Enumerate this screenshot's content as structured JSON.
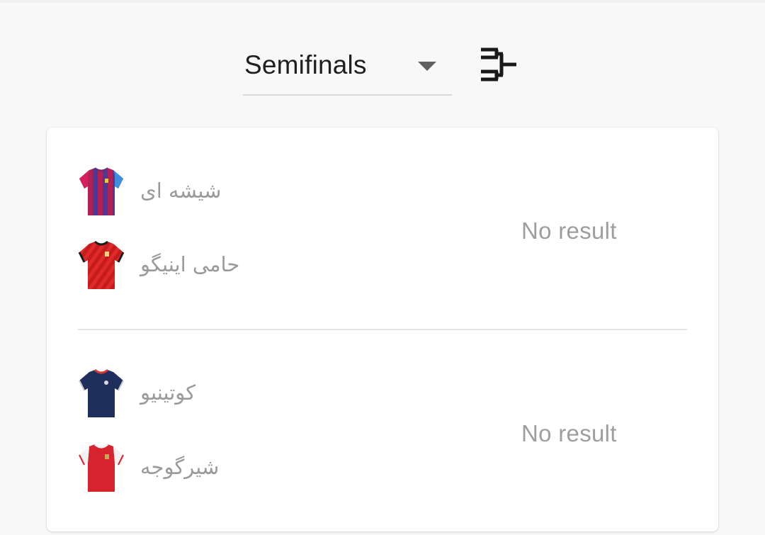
{
  "round_selector": {
    "selected": "Semifinals"
  },
  "icons": {
    "dropdown": "dropdown-caret-icon",
    "bracket": "tournament-bracket-icon"
  },
  "matches": [
    {
      "home": {
        "name": "شیشه ای",
        "kit": "blue-maroon-striped"
      },
      "away": {
        "name": "حامی اینیگو",
        "kit": "red-striped"
      },
      "result": "No result"
    },
    {
      "home": {
        "name": "کوتینیو",
        "kit": "navy"
      },
      "away": {
        "name": "شیرگوجه",
        "kit": "red-white-sleeves"
      },
      "result": "No result"
    }
  ]
}
